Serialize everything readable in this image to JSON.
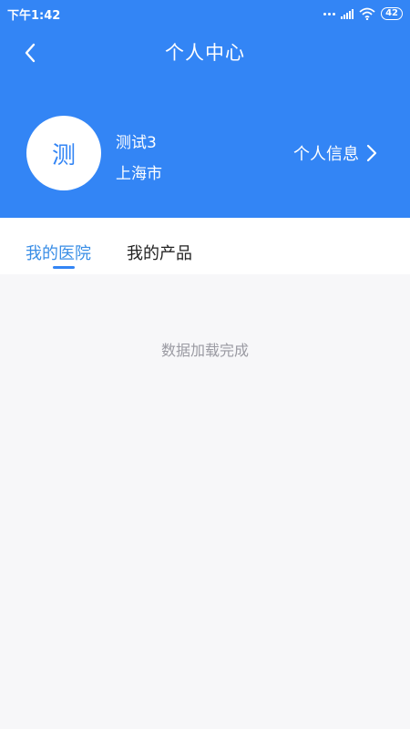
{
  "status_bar": {
    "time": "下午1:42",
    "battery": "42"
  },
  "header": {
    "title": "个人中心"
  },
  "profile": {
    "avatar_char": "测",
    "name": "测试3",
    "city": "上海市",
    "info_link": "个人信息"
  },
  "tabs": [
    {
      "label": "我的医院",
      "active": true
    },
    {
      "label": "我的产品",
      "active": false
    }
  ],
  "content": {
    "message": "数据加载完成"
  },
  "colors": {
    "brand": "#3385f5",
    "active_tab": "#3a8ee6",
    "muted_text": "#9a9aa2"
  }
}
